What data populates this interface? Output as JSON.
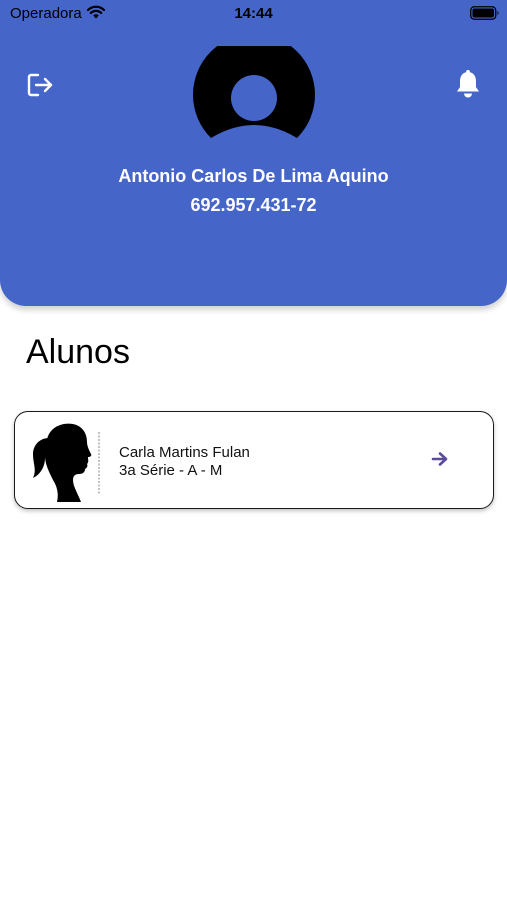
{
  "status_bar": {
    "carrier": "Operadora",
    "time": "14:44",
    "wifi_icon": "wifi-icon",
    "battery_icon": "battery-icon"
  },
  "header": {
    "background_color": "#4565c9",
    "logout_icon": "logout-icon",
    "notifications_icon": "bell-icon",
    "avatar_icon": "user-avatar-icon",
    "user_name": "Antonio Carlos De Lima Aquino",
    "user_document": "692.957.431-72"
  },
  "main": {
    "section_title": "Alunos",
    "students": [
      {
        "name": "Carla Martins Fulan",
        "class": "3a Série - A - M",
        "photo_icon": "girl-silhouette",
        "action_icon": "arrow-right-icon",
        "accent_color": "#5b4a9e"
      }
    ]
  }
}
